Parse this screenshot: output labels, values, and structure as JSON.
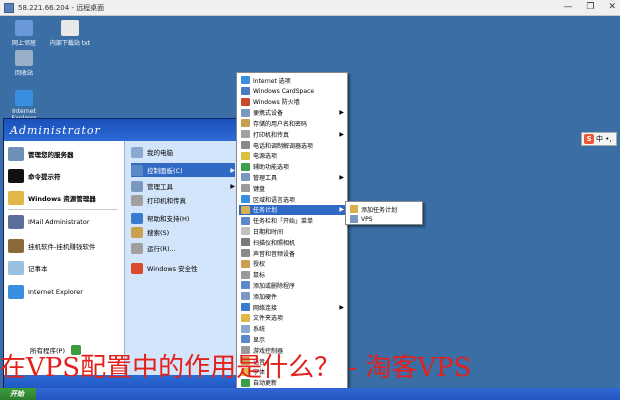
{
  "window": {
    "title": "58.221.66.204 - 远程桌面",
    "controls": [
      "—",
      "❐",
      "✕"
    ]
  },
  "desktop_icons": [
    {
      "label": "网上邻居",
      "color": "#6a98d8"
    },
    {
      "label": "内部下载站 txt",
      "color": "#e8e8e8"
    },
    {
      "label": "回收站",
      "color": "#9ab0c8"
    },
    {
      "label": "Internet Explorer",
      "color": "#3a8ee0"
    }
  ],
  "start_menu": {
    "user": "Administrator",
    "left_items": [
      {
        "label": "管理您的服务器",
        "bold": true,
        "color": "#6e8fb8"
      },
      {
        "label": "命令提示符",
        "bold": true,
        "color": "#111111"
      },
      {
        "label": "Windows 资源管理器",
        "bold": true,
        "color": "#e0b84a"
      },
      {
        "label": "IMail Administrator",
        "bold": false,
        "color": "#5a6e9a"
      },
      {
        "label": "挂机软件-挂机赚钱软件",
        "bold": false,
        "color": "#8b6a3a"
      },
      {
        "label": "记事本",
        "bold": false,
        "color": "#9ac0e0"
      },
      {
        "label": "Internet Explorer",
        "bold": false,
        "color": "#3a8ee0"
      }
    ],
    "all_programs": "所有程序(P)",
    "right_items": [
      {
        "label": "我的电脑",
        "arrow": "",
        "color": "#8aa8d0",
        "hl": false
      },
      {
        "label": "控制面板(C)",
        "arrow": "▶",
        "color": "#5a88c8",
        "hl": true
      },
      {
        "label": "管理工具",
        "arrow": "▶",
        "color": "#7a98c0",
        "hl": false
      },
      {
        "label": "打印机和传真",
        "arrow": "",
        "color": "#a0a0a0",
        "hl": false
      },
      {
        "label": "帮助和支持(H)",
        "arrow": "",
        "color": "#3a7ad0",
        "hl": false
      },
      {
        "label": "搜索(S)",
        "arrow": "",
        "color": "#c8a050",
        "hl": false
      },
      {
        "label": "运行(R)...",
        "arrow": "",
        "color": "#a0a0a0",
        "hl": false
      },
      {
        "label": "Windows 安全性",
        "arrow": "",
        "color": "#d84a2a",
        "hl": false
      }
    ]
  },
  "control_panel": {
    "items": [
      {
        "label": "Internet 选项",
        "arrow": "",
        "color": "#3a8ee0"
      },
      {
        "label": "Windows CardSpace",
        "arrow": "",
        "color": "#4a7ac0"
      },
      {
        "label": "Windows 防火墙",
        "arrow": "",
        "color": "#c84a2a"
      },
      {
        "label": "便携式设备",
        "arrow": "▶",
        "color": "#7a98c0"
      },
      {
        "label": "存储的用户名和密码",
        "arrow": "",
        "color": "#c8a050"
      },
      {
        "label": "打印机和传真",
        "arrow": "▶",
        "color": "#a0a0a0"
      },
      {
        "label": "电话和调制解调器选项",
        "arrow": "",
        "color": "#8a8a8a"
      },
      {
        "label": "电源选项",
        "arrow": "",
        "color": "#d8c040"
      },
      {
        "label": "辅助功能选项",
        "arrow": "",
        "color": "#3aa048"
      },
      {
        "label": "管理工具",
        "arrow": "▶",
        "color": "#7a98c0"
      },
      {
        "label": "键盘",
        "arrow": "",
        "color": "#9a9a9a"
      },
      {
        "label": "区域和语言选项",
        "arrow": "",
        "color": "#3a8ee0"
      },
      {
        "label": "任务计划",
        "arrow": "▶",
        "color": "#d8b050",
        "hl": true
      },
      {
        "label": "任务栏和「开始」菜单",
        "arrow": "",
        "color": "#5a88c8"
      },
      {
        "label": "日期和时间",
        "arrow": "",
        "color": "#c0c0c0"
      },
      {
        "label": "扫描仪和照相机",
        "arrow": "",
        "color": "#7a7a7a"
      },
      {
        "label": "声音和音频设备",
        "arrow": "",
        "color": "#8a8a8a"
      },
      {
        "label": "授权",
        "arrow": "",
        "color": "#c8a050"
      },
      {
        "label": "鼠标",
        "arrow": "",
        "color": "#9a9a9a"
      },
      {
        "label": "添加或删除程序",
        "arrow": "",
        "color": "#5a88c8"
      },
      {
        "label": "添加硬件",
        "arrow": "",
        "color": "#7a98c0"
      },
      {
        "label": "网络连接",
        "arrow": "▶",
        "color": "#3a7ad0"
      },
      {
        "label": "文件夹选项",
        "arrow": "",
        "color": "#e0b84a"
      },
      {
        "label": "系统",
        "arrow": "",
        "color": "#8aa8d0"
      },
      {
        "label": "显示",
        "arrow": "",
        "color": "#5a88c8"
      },
      {
        "label": "游戏控制器",
        "arrow": "",
        "color": "#9a9a9a"
      },
      {
        "label": "语音",
        "arrow": "",
        "color": "#c8a050"
      },
      {
        "label": "字体",
        "arrow": "",
        "color": "#e0b84a"
      },
      {
        "label": "自动更新",
        "arrow": "",
        "color": "#3aa048"
      }
    ]
  },
  "task_menu": {
    "items": [
      {
        "label": "添加任务计划",
        "color": "#d8b050"
      },
      {
        "label": "VPS",
        "color": "#7a98c0"
      }
    ]
  },
  "ime": {
    "label": "中 •,"
  },
  "taskbar": {
    "start": "开始"
  },
  "watermark": "在VPS配置中的作用是什么？ - 淘客VPS",
  "colors": {
    "desktop": "#3a6ea5",
    "highlight": "#316ac5",
    "watermark": "#e3201b"
  }
}
